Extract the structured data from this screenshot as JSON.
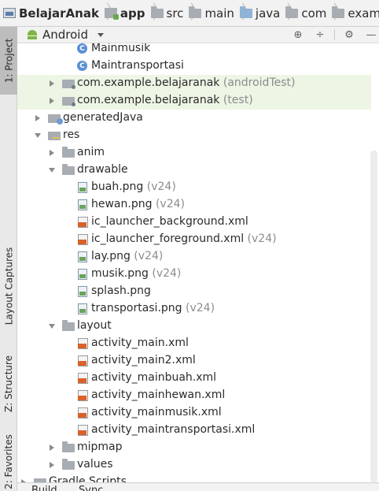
{
  "breadcrumb": [
    {
      "label": "BelajarAnak",
      "icon": "project-folder-icon",
      "bold": true
    },
    {
      "label": "app",
      "icon": "module-folder-icon",
      "bold": true
    },
    {
      "label": "src",
      "icon": "folder-icon"
    },
    {
      "label": "main",
      "icon": "folder-icon"
    },
    {
      "label": "java",
      "icon": "source-folder-icon"
    },
    {
      "label": "com",
      "icon": "package-icon"
    },
    {
      "label": "exam",
      "icon": "package-icon"
    }
  ],
  "side_tabs": {
    "project": "1: Project",
    "layout_captures": "Layout Captures",
    "structure": "Z: Structure",
    "favorites": "2: Favorites"
  },
  "tool_window": {
    "view_mode": "Android"
  },
  "tree": {
    "mainmusik": "Mainmusik",
    "maintransportasi": "Maintransportasi",
    "pkg_android_test": {
      "name": "com.example.belajaranak",
      "suffix": " (androidTest)"
    },
    "pkg_test": {
      "name": "com.example.belajaranak",
      "suffix": " (test)"
    },
    "generated_java": "generatedJava",
    "res": "res",
    "anim": "anim",
    "drawable": "drawable",
    "buah": {
      "name": "buah.png",
      "suffix": " (v24)"
    },
    "hewan": {
      "name": "hewan.png",
      "suffix": " (v24)"
    },
    "ic_bg": {
      "name": "ic_launcher_background.xml",
      "suffix": ""
    },
    "ic_fg": {
      "name": "ic_launcher_foreground.xml",
      "suffix": " (v24)"
    },
    "lay": {
      "name": "lay.png",
      "suffix": " (v24)"
    },
    "musik": {
      "name": "musik.png",
      "suffix": " (v24)"
    },
    "splash": {
      "name": "splash.png",
      "suffix": ""
    },
    "transportasi": {
      "name": "transportasi.png",
      "suffix": " (v24)"
    },
    "layout": "layout",
    "activity_main": "activity_main.xml",
    "activity_main2": "activity_main2.xml",
    "activity_mainbuah": "activity_mainbuah.xml",
    "activity_mainhewan": "activity_mainhewan.xml",
    "activity_mainmusik": "activity_mainmusik.xml",
    "activity_maintransportasi": "activity_maintransportasi.xml",
    "mipmap": "mipmap",
    "values": "values",
    "gradle_scripts": "Gradle Scripts"
  },
  "bottom_tabs": {
    "build": "Build",
    "sync": "Sync"
  },
  "colors": {
    "highlight_row": "#edf5e5",
    "package_text": "#2d5f8a",
    "suffix_text": "#8c8c8c"
  }
}
